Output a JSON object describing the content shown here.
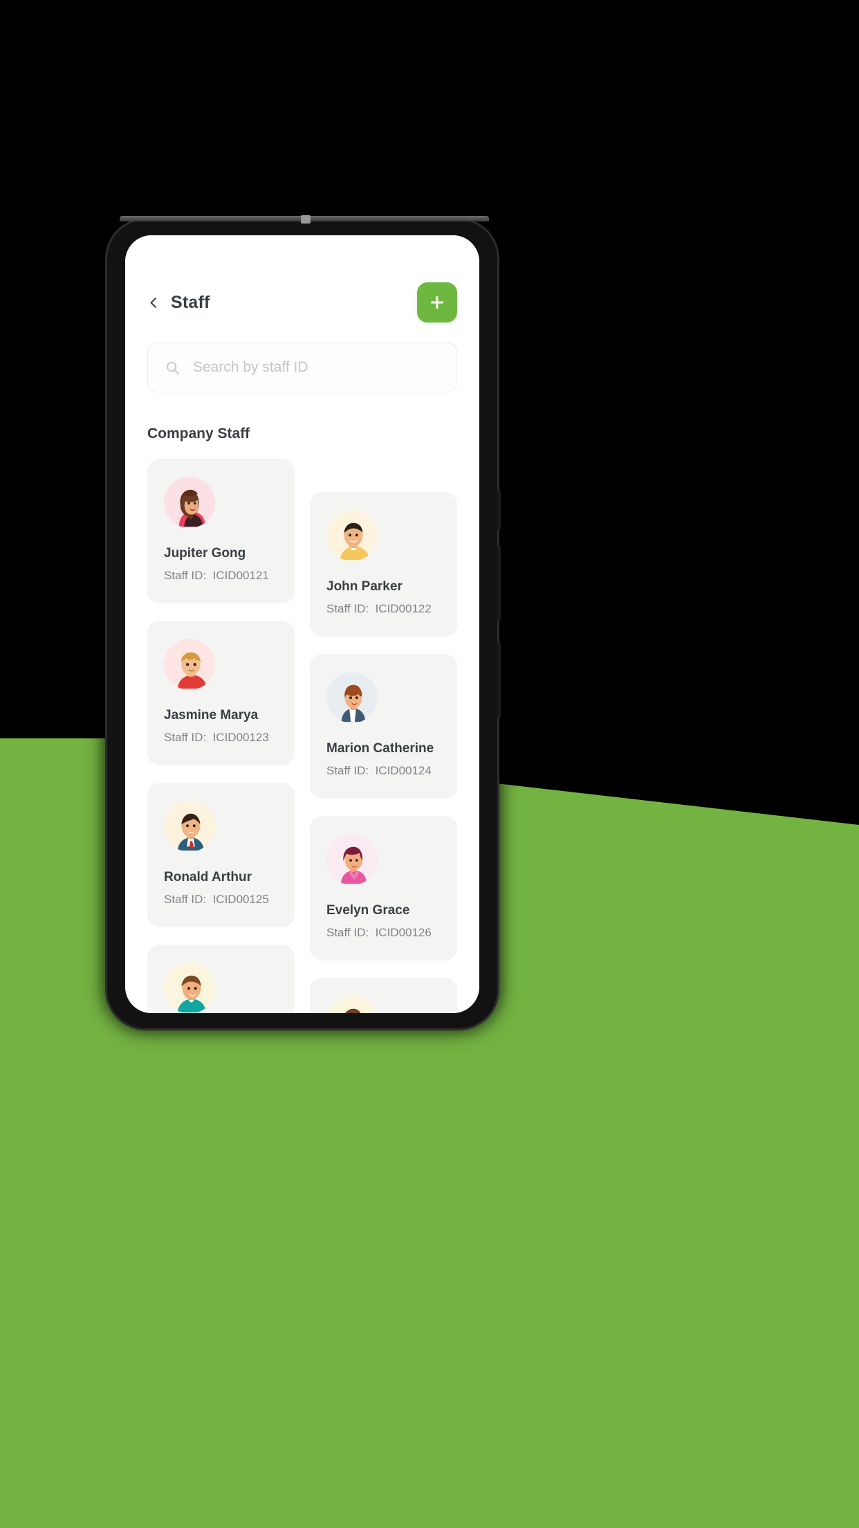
{
  "colors": {
    "green_background": "#73b342",
    "green_accent": "#6fb83f",
    "card_background": "#f4f4f3",
    "text_primary": "#3a3f44",
    "text_secondary": "#7e8488"
  },
  "appbar": {
    "back_icon": "chevron-left-icon",
    "title": "Staff",
    "add_icon": "plus-icon"
  },
  "search": {
    "icon": "search-icon",
    "placeholder": "Search by staff ID",
    "value": ""
  },
  "section": {
    "title": "Company Staff"
  },
  "staff_id_label": "Staff ID:",
  "columns": {
    "left": [
      {
        "name": "Jupiter Gong",
        "id_label": "Staff ID:",
        "staff_id": "ICID00121",
        "avatar": "avatar-woman-brown-bob",
        "avatar_bg": "#fbe0e6"
      },
      {
        "name": "Jasmine Marya",
        "id_label": "Staff ID:",
        "staff_id": "ICID00123",
        "avatar": "avatar-man-blonde-red-shirt",
        "avatar_bg": "#fde5e3"
      },
      {
        "name": "Ronald Arthur",
        "id_label": "Staff ID:",
        "staff_id": "ICID00125",
        "avatar": "avatar-man-suit-tie",
        "avatar_bg": "#fbf3dd"
      },
      {
        "name": "",
        "id_label": "",
        "staff_id": "",
        "avatar": "avatar-man-teal-shirt",
        "avatar_bg": "#fbf5de"
      }
    ],
    "right": [
      {
        "name": "John Parker",
        "id_label": "Staff ID:",
        "staff_id": "ICID00122",
        "avatar": "avatar-man-yellow-shirt",
        "avatar_bg": "#fbf3dd"
      },
      {
        "name": "Marion Catherine",
        "id_label": "Staff ID:",
        "staff_id": "ICID00124",
        "avatar": "avatar-woman-blazer",
        "avatar_bg": "#e8edf2"
      },
      {
        "name": "Evelyn Grace",
        "id_label": "Staff ID:",
        "staff_id": "ICID00126",
        "avatar": "avatar-woman-pink-top",
        "avatar_bg": "#faeaf2"
      },
      {
        "name": "",
        "id_label": "",
        "staff_id": "",
        "avatar": "avatar-woman-dark-hair",
        "avatar_bg": "#fbf5de"
      }
    ]
  }
}
